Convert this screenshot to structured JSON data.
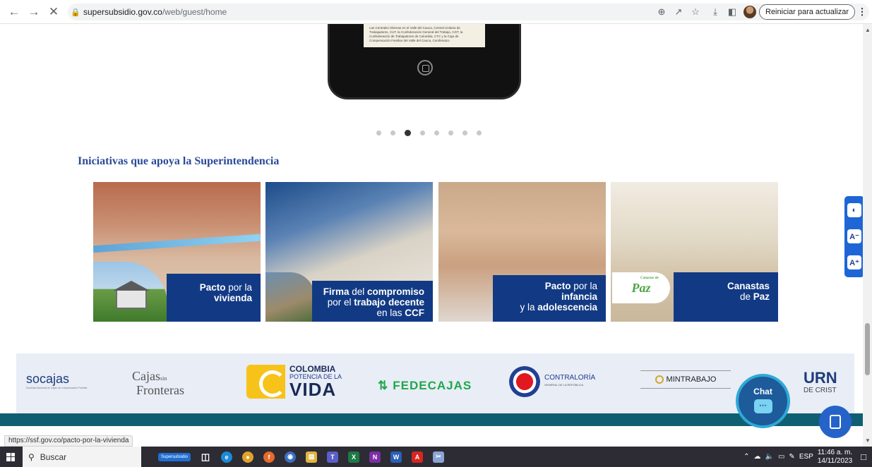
{
  "browser": {
    "url_host": "supersubsidio.gov.co",
    "url_path": "/web/guest/home",
    "update_button": "Reiniciar para actualizar",
    "icons": [
      "back-icon",
      "forward-icon",
      "close-icon",
      "lock-icon",
      "zoom-icon",
      "share-icon",
      "star-icon",
      "download-icon",
      "sidepanel-icon",
      "kebab-icon"
    ]
  },
  "phone": {
    "screen_text": "Las Centrales Obreras en el Valle del Cauca, Central Unitaria de Trabajadores, CUT, la Confederación General del Trabajo, CGT, la Confederación de Trabajadores de Colombia, CTC y la Caja de Compensación Familiar del Valle del Cauca, Comfenalco"
  },
  "carousel": {
    "dot_count": 8,
    "active_index": 2
  },
  "section": {
    "title": "Iniciativas que apoya la Superintendencia"
  },
  "cards": [
    {
      "line1_bold": "Pacto",
      "line1_rest": " por la",
      "line2_bold": "vivienda"
    },
    {
      "line1_bold": "Firma",
      "line1_mid": " del ",
      "line1_bold2": "compromiso",
      "line2_pre": "por el ",
      "line2_bold": "trabajo decente",
      "line3_pre": "en las ",
      "line3_bold": "CCF"
    },
    {
      "line1_bold": "Pacto",
      "line1_rest": " por la",
      "line2_bold": "infancia",
      "line3_pre": "y la ",
      "line3_bold": "adolescencia"
    },
    {
      "line1_bold": "Canastas",
      "line2_pre": "de ",
      "line2_bold": "Paz",
      "logo_small": "Canastas de",
      "logo": "Paz"
    }
  ],
  "partners": {
    "socajas": "socajas",
    "socajas_sub": "Sociedad Nacional de Cajas de Compensación Familiar",
    "cajas_top": "Cajas",
    "cajas_sin": "sin",
    "cajas_bottom": "Fronteras",
    "colombia_top": "COLOMBIA",
    "colombia_mid": "POTENCIA DE LA",
    "colombia_big": "VIDA",
    "fedecajas": "FEDECAJAS",
    "contraloria": "CONTRALORÍA",
    "contraloria_sub": "GENERAL DE LA REPÚBLICA",
    "mintrabajo": "MINTRABAJO",
    "urn": "URN",
    "urn_sub": "DE CRIST"
  },
  "chat": {
    "label": "Chat"
  },
  "accessibility": {
    "contrast": "◐",
    "decrease": "A⁻",
    "increase": "A⁺"
  },
  "status_bar": {
    "url": "https://ssf.gov.co/pacto-por-la-vivienda"
  },
  "taskbar": {
    "search": "Buscar",
    "supersubsidio_tab": "Supersubsidio",
    "language": "ESP",
    "time": "11:46 a. m.",
    "date": "14/11/2023"
  }
}
